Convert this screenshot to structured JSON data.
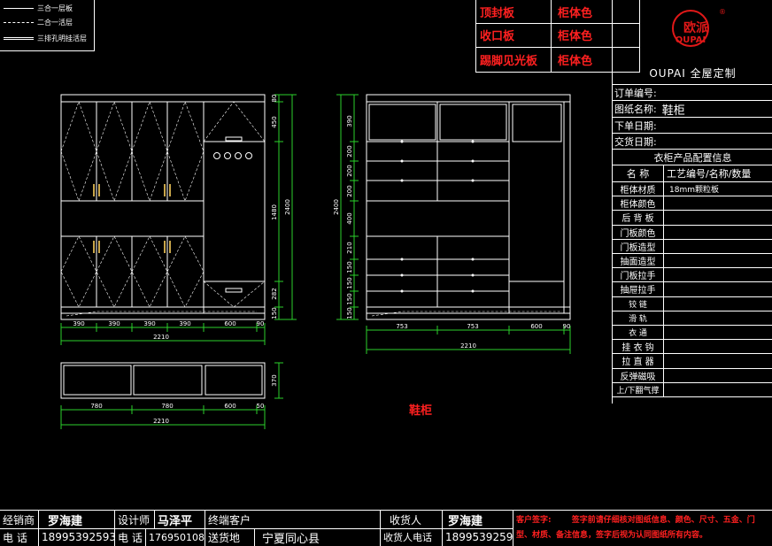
{
  "legend": {
    "items": [
      "三合一层板",
      "二合一活层",
      "三排孔明挂活层"
    ]
  },
  "top_table": {
    "rows": [
      {
        "name": "顶封板",
        "color": "柜体色"
      },
      {
        "name": "收口板",
        "color": "柜体色"
      },
      {
        "name": "踢脚见光板",
        "color": "柜体色"
      }
    ]
  },
  "brand": {
    "logo_text": "OUPAI",
    "logo_glyph": "欧派",
    "registered_mark": "®",
    "tagline": "OUPAI  全屋定制"
  },
  "order_info": {
    "order_no_label": "订单编号:",
    "drawing_name_label": "图纸名称:",
    "drawing_name_value": "鞋柜",
    "order_date_label": "下单日期:",
    "delivery_date_label": "交货日期:"
  },
  "config": {
    "section_title": "衣柜产品配置信息",
    "header_name": "名    称",
    "header_value": "工艺编号/名称/数量",
    "rows": [
      {
        "k": "柜体材质",
        "v": "18mm颗粒板"
      },
      {
        "k": "柜体颜色",
        "v": ""
      },
      {
        "k": "后 背 板",
        "v": ""
      },
      {
        "k": "门板颜色",
        "v": ""
      },
      {
        "k": "门板造型",
        "v": ""
      },
      {
        "k": "抽面造型",
        "v": ""
      },
      {
        "k": "门板拉手",
        "v": ""
      },
      {
        "k": "抽屉拉手",
        "v": ""
      },
      {
        "k": "铰    链",
        "v": ""
      },
      {
        "k": "滑    轨",
        "v": ""
      },
      {
        "k": "衣    通",
        "v": ""
      },
      {
        "k": "挂 衣 钩",
        "v": ""
      },
      {
        "k": "拉 直 器",
        "v": ""
      },
      {
        "k": "反弹磁吸",
        "v": ""
      },
      {
        "k": "上/下翻气撑",
        "v": ""
      }
    ]
  },
  "drawing": {
    "title": "鞋柜",
    "front_left": {
      "widths": [
        "390",
        "390",
        "390",
        "390",
        "600",
        "90"
      ],
      "total": "2210",
      "heights": [
        "80",
        "450",
        "1480",
        "2400",
        "282",
        "150"
      ]
    },
    "front_right": {
      "widths": [
        "753",
        "753",
        "600",
        "90"
      ],
      "total": "2210",
      "heights": [
        "390",
        "200",
        "200",
        "200",
        "400",
        "2400",
        "210",
        "150",
        "150",
        "150",
        "150"
      ]
    },
    "plan": {
      "widths": [
        "780",
        "780",
        "600",
        "50"
      ],
      "total": "2210",
      "depth": "370"
    }
  },
  "footer": {
    "dealer_label": "经销商",
    "dealer_value": "罗海建",
    "designer_label": "设计师",
    "designer_value": "马泽平",
    "end_customer_label": "终端客户",
    "receiver_label": "收货人",
    "receiver_value": "罗海建",
    "phone_label": "电  话",
    "phone_value": "18995392593",
    "designer_phone_label": "电  话",
    "designer_phone_value": "17695010832",
    "delivery_place_label": "送货地",
    "delivery_place_value": "宁夏同心县",
    "receiver_phone_label": "收货人电话",
    "receiver_phone_value": "18995392593",
    "signature_label": "客户签字:",
    "signature_note": "签字前请仔细核对图纸信息、颜色、尺寸、五金、门型、材质、备注信息，签字后视为认同图纸所有内容。"
  }
}
